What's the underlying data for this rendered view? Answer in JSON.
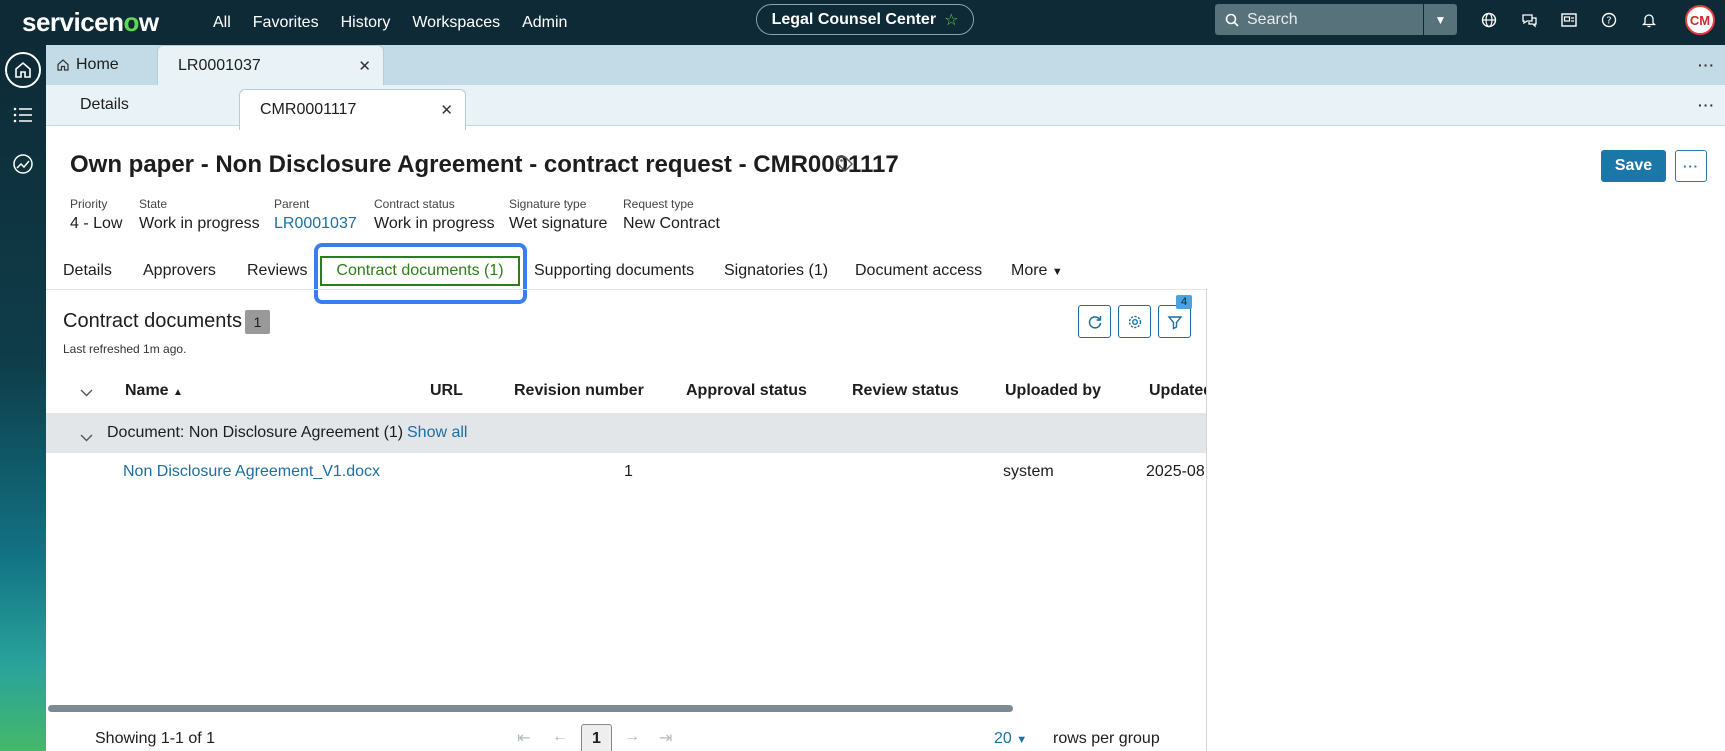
{
  "topnav": {
    "logo": "servicenow",
    "links": [
      "All",
      "Favorites",
      "History",
      "Workspaces",
      "Admin"
    ],
    "workspace_pill": "Legal Counsel Center",
    "search_placeholder": "Search",
    "avatar_initials": "CM"
  },
  "tabs_row1": {
    "home": "Home",
    "record_tab": "LR0001037"
  },
  "tabs_row2": {
    "details": "Details",
    "record_tab": "CMR0001117"
  },
  "record": {
    "title": "Own paper - Non Disclosure Agreement - contract request - CMR0001117",
    "save_label": "Save",
    "fields": [
      {
        "label": "Priority",
        "value": "4 - Low"
      },
      {
        "label": "State",
        "value": "Work in progress"
      },
      {
        "label": "Parent",
        "value": "LR0001037"
      },
      {
        "label": "Contract status",
        "value": "Work in progress"
      },
      {
        "label": "Signature type",
        "value": "Wet signature"
      },
      {
        "label": "Request type",
        "value": "New Contract"
      }
    ],
    "tabs": [
      "Details",
      "Approvers",
      "Reviews",
      "Contract documents (1)",
      "Supporting documents",
      "Signatories (1)",
      "Document access",
      "More"
    ]
  },
  "list": {
    "title": "Contract documents",
    "count": "1",
    "last_refreshed": "Last refreshed 1m ago.",
    "filter_badge": "4",
    "columns": [
      "Name",
      "URL",
      "Revision number",
      "Approval status",
      "Review status",
      "Uploaded by",
      "Updated"
    ],
    "group_label": "Document: Non Disclosure Agreement (1)",
    "show_all": "Show all",
    "rows": [
      {
        "name": "Non Disclosure Agreement_V1.docx",
        "revision": "1",
        "uploaded_by": "system",
        "updated": "2025-08"
      }
    ],
    "showing": "Showing 1-1 of 1",
    "current_page": "1",
    "rows_per_group_value": "20",
    "rows_per_group_label": "rows per group"
  },
  "colors": {
    "nav_bg": "#0e2a36",
    "accent_blue": "#1b77a8",
    "active_tab_green": "#2e7d1a",
    "focus_ring": "#3b7cf0"
  }
}
